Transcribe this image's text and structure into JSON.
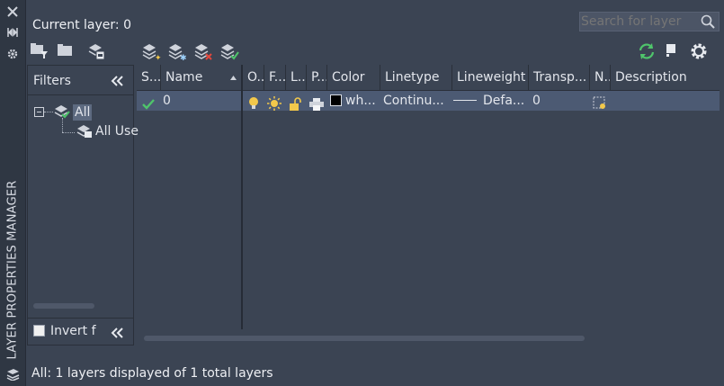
{
  "panel": {
    "vertical_title": "LAYER PROPERTIES MANAGER",
    "current_layer": "Current layer: 0",
    "search_placeholder": "Search for layer",
    "status": "All: 1 layers displayed of 1 total layers"
  },
  "filters": {
    "title": "Filters",
    "tree": [
      {
        "label": "All",
        "selected": true
      },
      {
        "label": "All Use"
      }
    ],
    "invert_label": "Invert f",
    "invert_checked": false
  },
  "grid": {
    "columns": [
      "S...",
      "Name",
      "O...",
      "F...",
      "L...",
      "P...",
      "Color",
      "Linetype",
      "Lineweight",
      "Transp...",
      "N...",
      "Description"
    ],
    "rows": [
      {
        "status": "current",
        "name": "0",
        "color_name": "wh...",
        "linetype": "Continu...",
        "lineweight": "Defa...",
        "transparency": "0",
        "description": ""
      }
    ]
  },
  "colors": {
    "background": "#3b4453",
    "selected_row": "#4c5a73",
    "refresh_icon": "#4fc46b",
    "check_icon": "#4fc46b",
    "bulb_icon": "#f2c84b"
  },
  "icons": [
    "close-icon",
    "autohide-icon",
    "settings-icon",
    "new-property-filter-icon",
    "new-group-filter-icon",
    "layer-states-icon",
    "new-layer-icon",
    "new-layer-vp-frozen-icon",
    "delete-layer-icon",
    "set-current-icon",
    "refresh-icon",
    "stop-icon",
    "gear-icon",
    "search-icon"
  ]
}
